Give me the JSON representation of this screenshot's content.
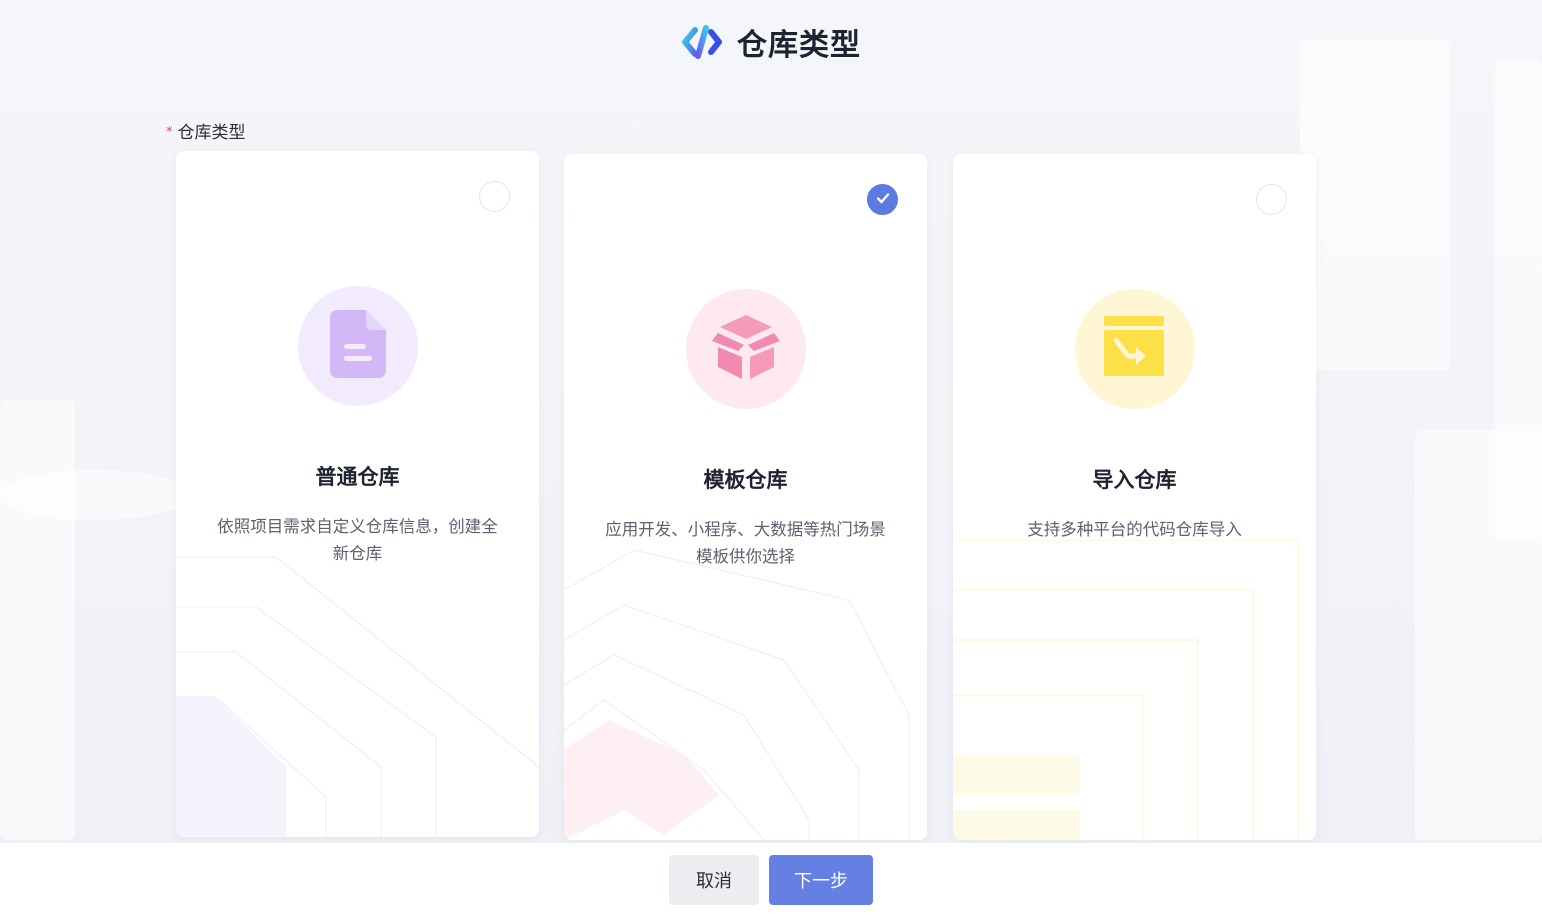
{
  "header": {
    "title": "仓库类型",
    "logo_icon": "code-logo-icon"
  },
  "form": {
    "label": "仓库类型",
    "required_mark": "*",
    "options": [
      {
        "title": "普通仓库",
        "description": "依照项目需求自定义仓库信息，创建全新仓库",
        "icon": "document-icon",
        "selected": false,
        "accent": "#d3b7f7"
      },
      {
        "title": "模板仓库",
        "description": "应用开发、小程序、大数据等热门场景模板供你选择",
        "icon": "box-icon",
        "selected": true,
        "accent": "#f3a2bb"
      },
      {
        "title": "导入仓库",
        "description": "支持多种平台的代码仓库导入",
        "icon": "import-box-icon",
        "selected": false,
        "accent": "#fde047"
      }
    ]
  },
  "footer": {
    "cancel_label": "取消",
    "next_label": "下一步"
  },
  "colors": {
    "primary": "#6580e3",
    "check": "#5b7be3",
    "required": "#e5484d"
  }
}
